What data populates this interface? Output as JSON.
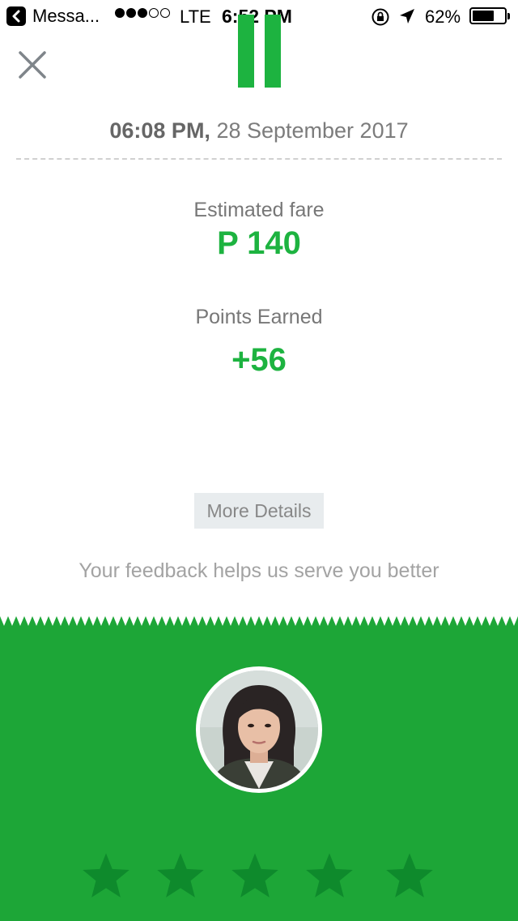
{
  "status_bar": {
    "back_app": "Messa...",
    "carrier": "LTE",
    "time": "6:52 PM",
    "battery": "62%",
    "signal_filled": 3,
    "signal_total": 5,
    "battery_level": 0.62
  },
  "header": {
    "close_icon": "close-icon",
    "pause_icon": "pause-icon"
  },
  "trip": {
    "time": "06:08 PM,",
    "date": " 28 September 2017",
    "fare_label": "Estimated fare",
    "fare_value": "P 140",
    "points_label": "Points Earned",
    "points_value": "+56"
  },
  "actions": {
    "more_details": "More Details"
  },
  "feedback": {
    "prompt": "Your feedback helps us serve you better"
  },
  "rating": {
    "stars_total": 5,
    "stars_selected": 0
  },
  "colors": {
    "accent_green": "#1db340",
    "panel_green": "#1da637",
    "star_green": "#0e8a2c"
  }
}
